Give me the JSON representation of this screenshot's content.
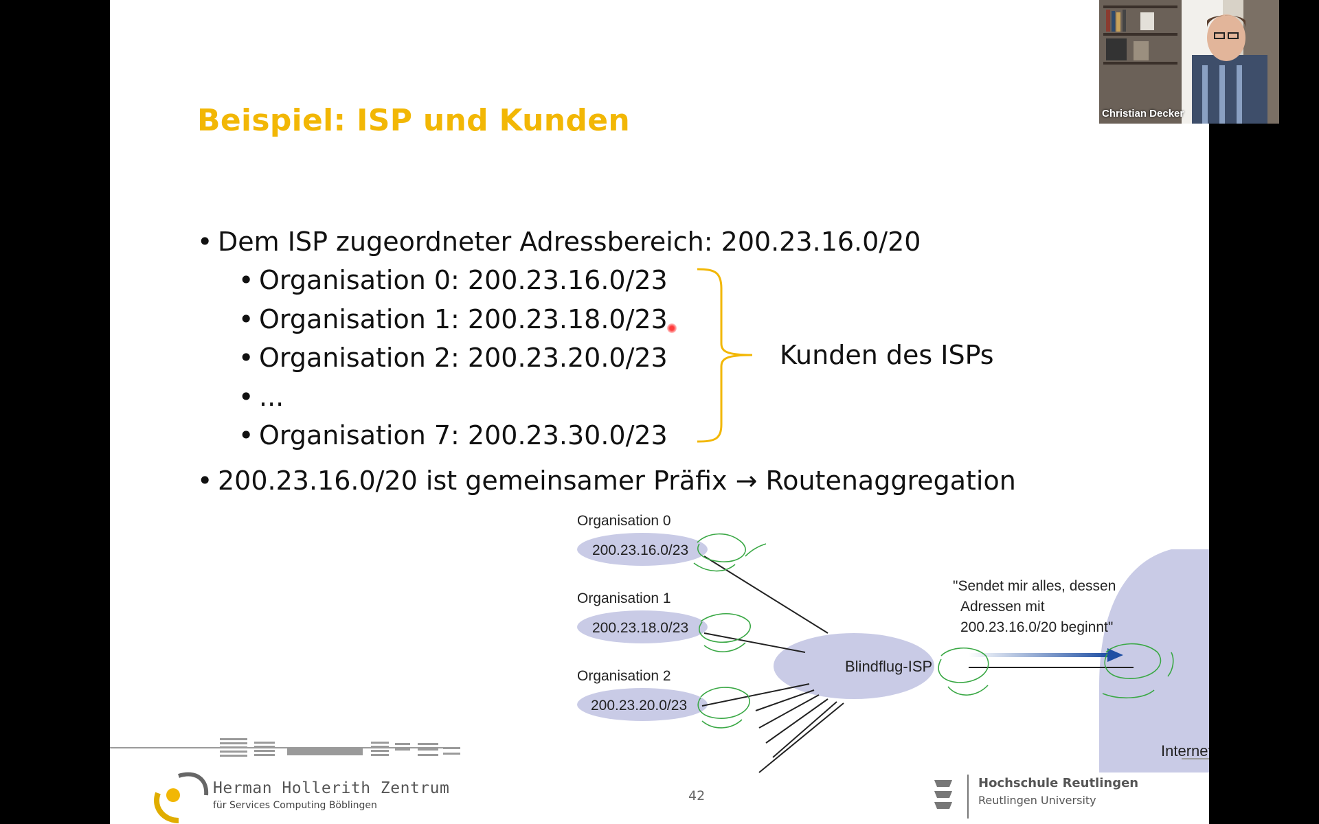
{
  "slide": {
    "title": "Beispiel: ISP und Kunden",
    "bullets": {
      "b1": "Dem ISP zugeordneter Adressbereich: 200.23.16.0/20",
      "sub": [
        "Organisation 0: 200.23.16.0/23",
        "Organisation 1: 200.23.18.0/23",
        "Organisation 2: 200.23.20.0/23",
        "...",
        "Organisation 7: 200.23.30.0/23"
      ],
      "b2": "200.23.16.0/20 ist gemeinsamer Präfix → Routenaggregation",
      "bullet_char": "•"
    },
    "bracket_label": "Kunden des ISPs",
    "diagram": {
      "orgs": [
        {
          "label": "Organisation 0",
          "prefix": "200.23.16.0/23"
        },
        {
          "label": "Organisation 1",
          "prefix": "200.23.18.0/23"
        },
        {
          "label": "Organisation 2",
          "prefix": "200.23.20.0/23"
        }
      ],
      "isp": "Blindflug-ISP",
      "quote_line1": "\"Sendet mir alles, dessen",
      "quote_line2": "Adressen mit",
      "quote_line3": "200.23.16.0/20 beginnt\"",
      "internet": "Internet"
    },
    "footer": {
      "logo_line1": "Herman Hollerith Zentrum",
      "logo_line2": "für Services Computing Böblingen",
      "page_number": "42",
      "university_line1": "Hochschule Reutlingen",
      "university_line2": "Reutlingen University"
    }
  },
  "webcam": {
    "name": "Christian Decker"
  },
  "colors": {
    "title": "#f2b705",
    "bracket": "#f2b705",
    "cloud": "#c9cbe6",
    "arrow": "#1f4fa3",
    "annotation": "#3aa845"
  }
}
